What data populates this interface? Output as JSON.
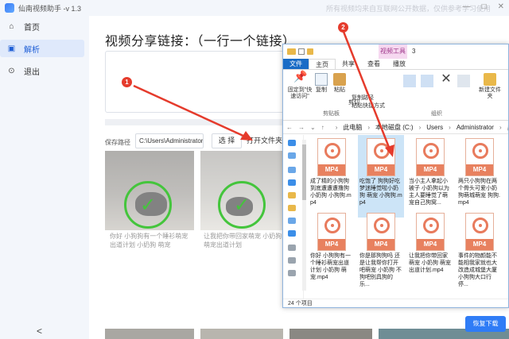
{
  "app": {
    "title": "仙南视频助手 -v 1.3",
    "watermark": "所有视频均来自互联网公开数据，仅供参考学习使用",
    "window_controls": [
      "—",
      "□",
      "✕"
    ]
  },
  "sidebar": {
    "items": [
      {
        "label": "首页",
        "icon": "home-icon",
        "glyph": "⌂"
      },
      {
        "label": "解析",
        "icon": "parse-icon",
        "glyph": "▣"
      },
      {
        "label": "退出",
        "icon": "exit-icon",
        "glyph": "⊙"
      }
    ],
    "collapse": "<"
  },
  "main": {
    "title": "视频分享链接：（一行一个链接）",
    "save_label": "保存路径",
    "save_path": "C:\\Users\\Administrator\\",
    "browse": "选 择",
    "open_folder": "打开文件夹",
    "captions": [
      "你好 小狗狗有一个睡衫萌宠出道计划 小奶狗 萌宠",
      "让我把你带回家萌宠 小奶狗 萌宠出道计划"
    ],
    "restore": "恢复下载"
  },
  "explorer": {
    "context_tab": "视频工具",
    "title_num": "3",
    "tabs": [
      "文件",
      "主页",
      "共享",
      "查看",
      "播放"
    ],
    "ribbon": {
      "pin": "固定到\"快速访问\"",
      "copy": "复制",
      "paste": "粘贴",
      "copy_path": "复制路径",
      "paste_shortcut": "粘贴快捷方式",
      "cut": "剪切",
      "clipboard": "剪贴板",
      "organize": "组织",
      "new_folder": "新建文件夹"
    },
    "address": [
      "此电脑",
      "本地磁盘 (C:)",
      "Users",
      "Administrator",
      "桌面"
    ],
    "files": [
      "成了精的小狗狗到底遭遭遭撸狗小奶狗 小狗狗.mp4",
      "吃饱了 狗狗好吃梦迷睡觉啦小奶狗 萌宠 小狗狗.mp4",
      "当小主人拿起小被子 小奶狗以为主人要睡觉了萌宠自己狗窝...",
      "两只小狗狗在两个骨头可爱小奶狗萌城萌宠 狗狗.mp4",
      "你好 小狗狗有一个睡衫萌宠出道计划 小奶狗 萌宠.mp4",
      "你是那狗狗吗 还是让我帮你打开吧萌宠 小奶狗 不狗吧别具狗的乐...",
      "让我把你带回家萌宠 小奶狗 萌宠出道计划.mp4",
      "事件的物颜能不能相我家就也大改造成城堡大厦小狗狗大口行停..."
    ],
    "file_tag": "MP4",
    "status": "24 个项目"
  },
  "annotations": [
    "1",
    "2"
  ],
  "colors": {
    "accent": "#2f7cf6",
    "check": "#44c53c",
    "mp4": "#e8815f",
    "annotation": "#e53b2c"
  }
}
